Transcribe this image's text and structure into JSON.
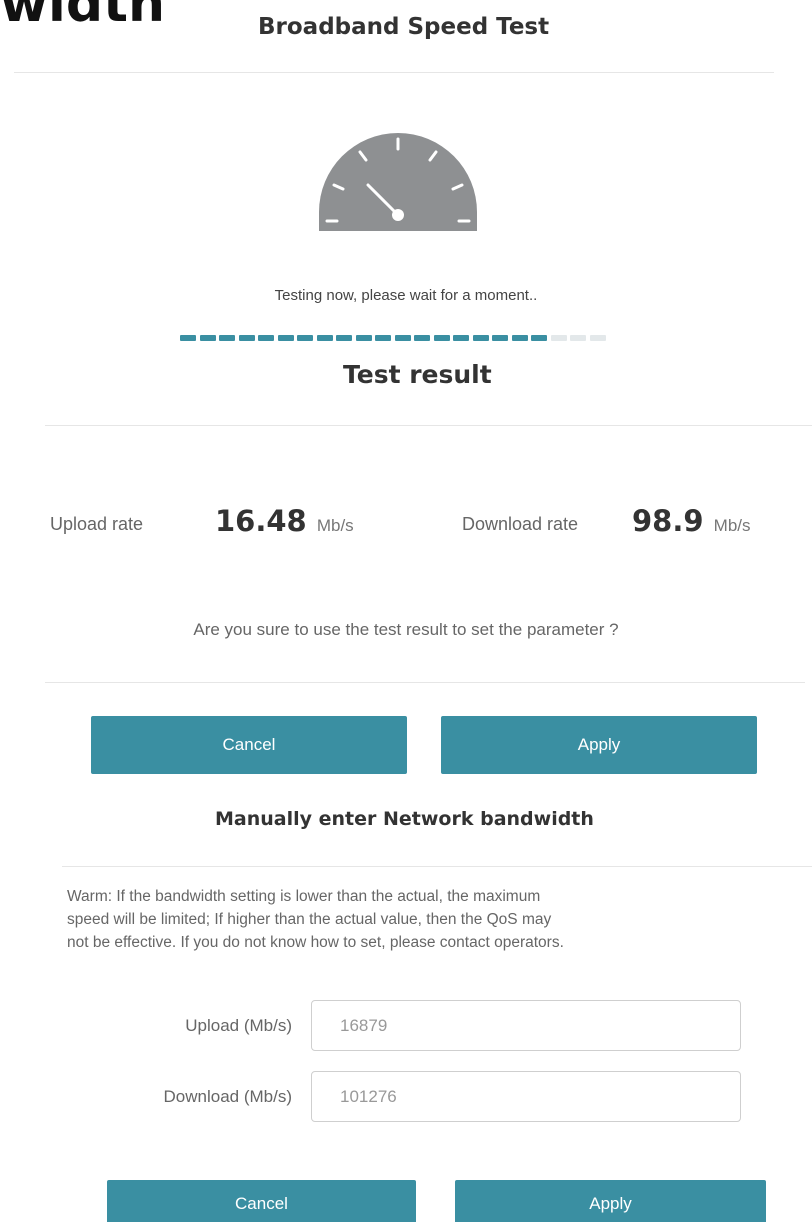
{
  "cut_heading": "width",
  "speed_test": {
    "title": "Broadband Speed Test",
    "status": "Testing now, please wait for a moment..",
    "progress_percent": 87,
    "gauge_icon": "speedometer-icon",
    "colors": {
      "accent": "#3a8fa2",
      "gauge": "#8e9092",
      "progress_done": "#3a8fa2",
      "progress_pending": "#e3e8ea"
    }
  },
  "result": {
    "title": "Test result",
    "upload_label": "Upload rate",
    "upload_value": "16.48",
    "upload_unit": "Mb/s",
    "download_label": "Download rate",
    "download_value": "98.9",
    "download_unit": "Mb/s",
    "confirm": "Are you sure to use the test result to set the parameter ?",
    "cancel_label": "Cancel",
    "apply_label": "Apply"
  },
  "manual": {
    "title": "Manually enter Network bandwidth",
    "warning_lines": [
      "Warm: If the bandwidth setting is lower than the actual, the maximum",
      "speed will be limited; If higher than the actual value, then the QoS may",
      "not be effective. If you do not know how to set, please contact operators."
    ],
    "upload_label": "Upload (Mb/s)",
    "upload_value": "16879",
    "download_label": "Download (Mb/s)",
    "download_value": "101276",
    "cancel_label": "Cancel",
    "apply_label": "Apply"
  }
}
